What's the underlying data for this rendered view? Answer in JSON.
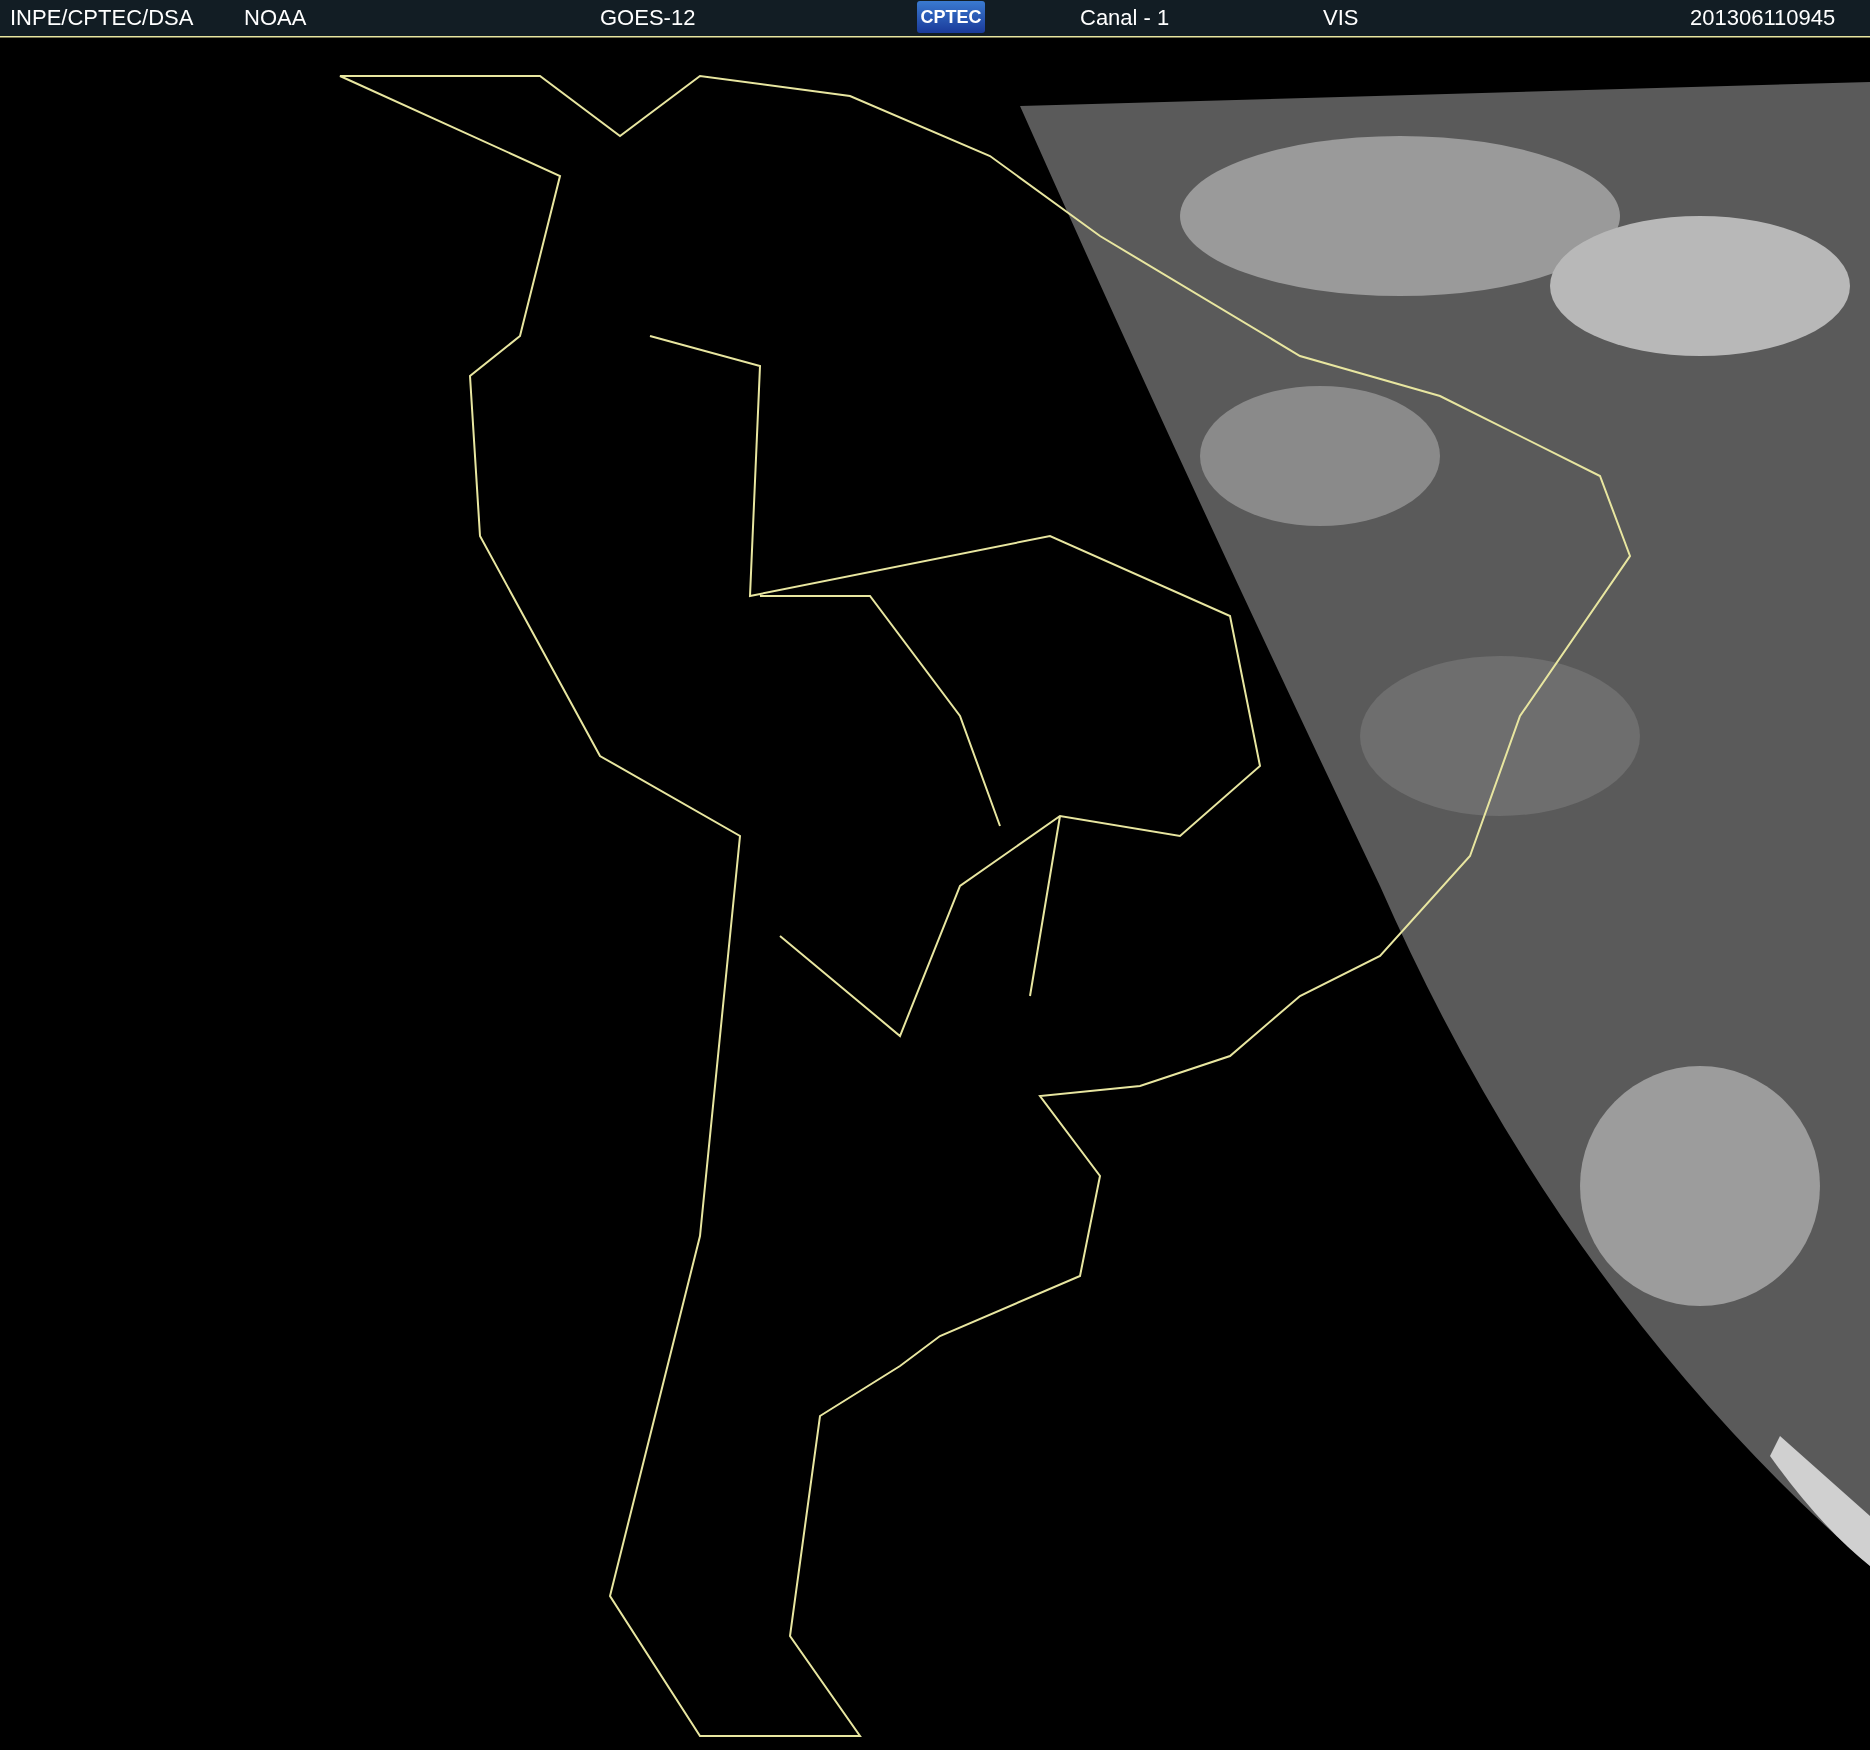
{
  "header": {
    "items": [
      {
        "kind": "text",
        "text": "INPE/CPTEC/DSA"
      },
      {
        "kind": "text",
        "text": "NOAA"
      },
      {
        "kind": "text",
        "text": "GOES-12"
      },
      {
        "kind": "logo",
        "text": "CPTEC"
      },
      {
        "kind": "text",
        "text": "Canal - 1"
      },
      {
        "kind": "text",
        "text": "VIS"
      },
      {
        "kind": "text",
        "text": "201306110945"
      }
    ]
  }
}
